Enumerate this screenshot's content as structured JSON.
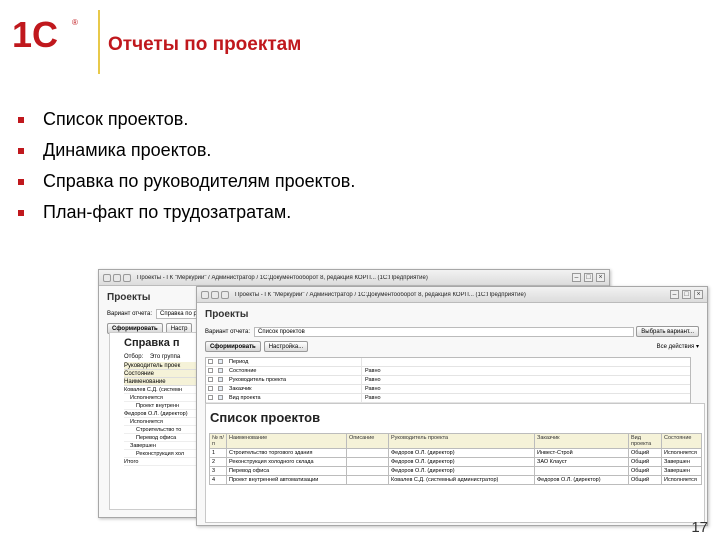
{
  "logo": {
    "text": "1С",
    "mark": "®"
  },
  "slide": {
    "title": "Отчеты по проектам",
    "page_number": "17"
  },
  "bullets": [
    "Список проектов.",
    "Динамика проектов.",
    "Справка по руководителям проектов.",
    "План-факт по трудозатратам."
  ],
  "colors": {
    "accent": "#c0181d",
    "divider": "#e8c94a",
    "report_header": "#f5f2d8"
  },
  "back_window": {
    "titlebar": "Проекты - ГК \"Меркурий\" / Администратор / 1С:Документооборот 8, редакция КОРП... (1С:Предприятие)",
    "form_title": "Проекты",
    "variant_label": "Вариант отчета:",
    "variant_value": "Справка по руков",
    "generate_button": "Сформировать",
    "settings_button": "Настр",
    "report_title": "Справка п",
    "filter_label": "Отбор:",
    "filter_value": "Это группа",
    "header_rows": [
      "Руководитель проек",
      "Состояние",
      "Наименование"
    ],
    "rows": [
      "Ковалев С.Д. (системн",
      "Исполняется",
      "Проект внутренн",
      "Федоров О.Л. (директор)",
      "Исполняется",
      "Строительство то",
      "Перевод офиса",
      "Завершен",
      "Реконструкция хол",
      "Итого"
    ]
  },
  "front_window": {
    "titlebar": "Проекты - ГК \"Меркурий\" / Администратор / 1С:Документооборот 8, редакция КОРП... (1С:Предприятие)",
    "form_title": "Проекты",
    "variant_label": "Вариант отчета:",
    "variant_value": "Список проектов",
    "choose_variant_button": "Выбрать вариант...",
    "generate_button": "Сформировать",
    "settings_button": "Настройка...",
    "all_actions": "Все действия ▾",
    "settings_rows": [
      {
        "field": "Период",
        "condition": ""
      },
      {
        "field": "Состояние",
        "condition": "Равно"
      },
      {
        "field": "Руководитель проекта",
        "condition": "Равно"
      },
      {
        "field": "Заказчик",
        "condition": "Равно"
      },
      {
        "field": "Вид проекта",
        "condition": "Равно"
      }
    ],
    "report_title": "Список проектов",
    "table": {
      "headers": [
        "№ п/п",
        "Наименование",
        "Описание",
        "Руководитель проекта",
        "Заказчик",
        "Вид проекта",
        "Состояние"
      ],
      "rows": [
        [
          "1",
          "Строительство торгового здания",
          "",
          "Федоров О.Л. (директор)",
          "Инвест-Строй",
          "Общий",
          "Исполняется"
        ],
        [
          "2",
          "Реконструкция холодного склада",
          "",
          "Федоров О.Л. (директор)",
          "ЗАО Клауст",
          "Общий",
          "Завершен"
        ],
        [
          "3",
          "Перевод офиса",
          "",
          "Федоров О.Л. (директор)",
          "",
          "Общий",
          "Завершен"
        ],
        [
          "4",
          "Проект внутренней автоматизации",
          "",
          "Ковалев С.Д. (системный администратор)",
          "Федоров О.Л. (директор)",
          "Общий",
          "Исполняется"
        ]
      ]
    }
  }
}
